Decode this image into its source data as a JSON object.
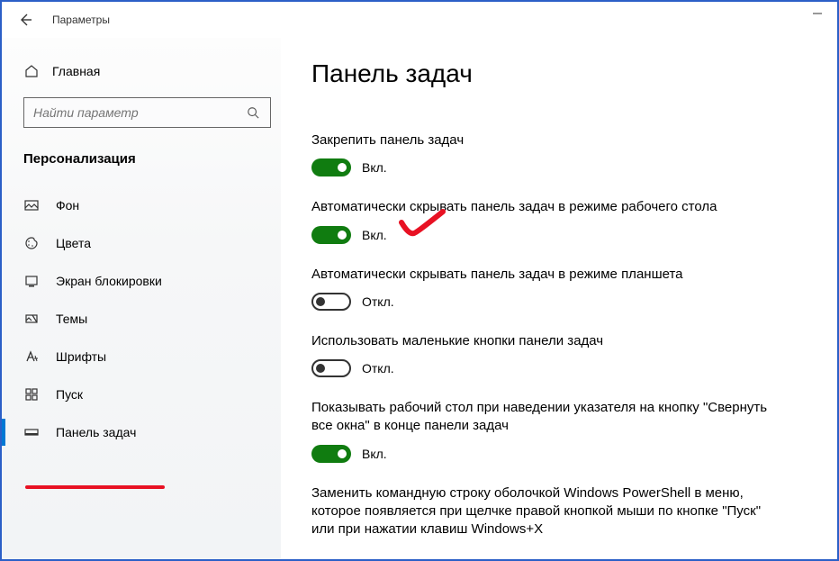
{
  "window": {
    "title": "Параметры"
  },
  "sidebar": {
    "home": "Главная",
    "search_placeholder": "Найти параметр",
    "section": "Персонализация",
    "items": [
      {
        "label": "Фон"
      },
      {
        "label": "Цвета"
      },
      {
        "label": "Экран блокировки"
      },
      {
        "label": "Темы"
      },
      {
        "label": "Шрифты"
      },
      {
        "label": "Пуск"
      },
      {
        "label": "Панель задач"
      }
    ]
  },
  "page": {
    "title": "Панель задач",
    "toggle_on": "Вкл.",
    "toggle_off": "Откл.",
    "settings": [
      {
        "label": "Закрепить панель задач",
        "state": true
      },
      {
        "label": "Автоматически скрывать панель задач в режиме рабочего стола",
        "state": true
      },
      {
        "label": "Автоматически скрывать панель задач в режиме планшета",
        "state": false
      },
      {
        "label": "Использовать маленькие кнопки панели задач",
        "state": false
      },
      {
        "label": "Показывать рабочий стол при наведении указателя на кнопку \"Свернуть все окна\" в конце панели задач",
        "state": true
      },
      {
        "label": "Заменить командную строку оболочкой Windows PowerShell в меню, которое появляется при щелчке правой кнопкой мыши по кнопке \"Пуск\" или при нажатии клавиш Windows+X",
        "state": null
      }
    ]
  }
}
